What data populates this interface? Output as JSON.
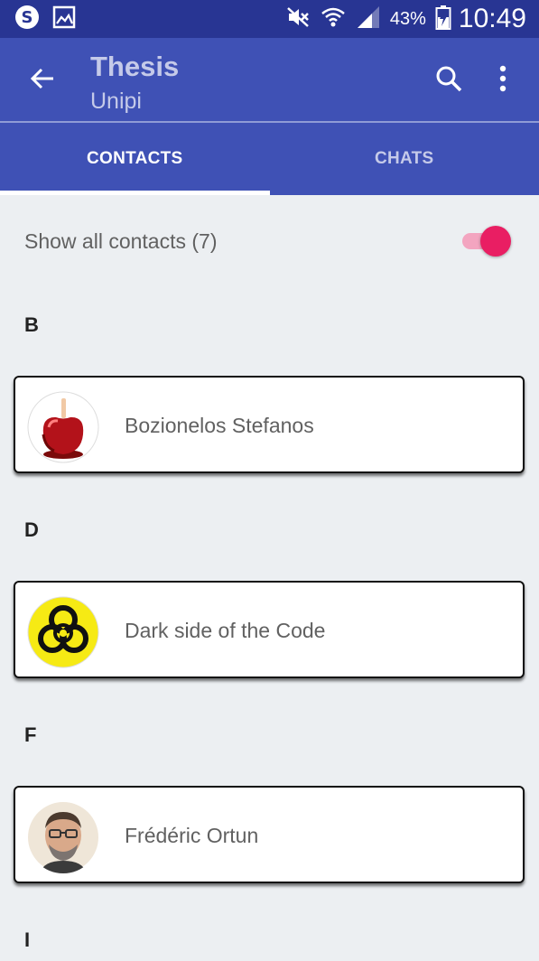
{
  "status_bar": {
    "left_icons": [
      "skype-icon",
      "gallery-icon"
    ],
    "right_icons": [
      "mute-icon",
      "wifi-icon",
      "signal-icon",
      "battery-icon"
    ],
    "battery_pct": "43%",
    "time": "10:49"
  },
  "app_bar": {
    "title": "Thesis",
    "subtitle": "Unipi",
    "back_icon": "arrow-back-icon",
    "search_icon": "search-icon",
    "more_icon": "more-vert-icon"
  },
  "tabs": [
    {
      "label": "CONTACTS",
      "active": true
    },
    {
      "label": "CHATS",
      "active": false
    }
  ],
  "show_all": {
    "label": "Show all contacts (7)",
    "enabled": true
  },
  "sections": [
    {
      "letter": "B",
      "contacts": [
        {
          "name": "Bozionelos Stefanos",
          "avatar": "candy-apple-avatar"
        }
      ]
    },
    {
      "letter": "D",
      "contacts": [
        {
          "name": "Dark side of the Code",
          "avatar": "biohazard-avatar"
        }
      ]
    },
    {
      "letter": "F",
      "contacts": [
        {
          "name": "Frédéric Ortun",
          "avatar": "person-photo-avatar"
        }
      ]
    },
    {
      "letter": "I",
      "contacts": []
    }
  ],
  "colors": {
    "status_bar": "#283593",
    "primary": "#3f51b5",
    "accent": "#e91e63",
    "background": "#eceff2"
  }
}
